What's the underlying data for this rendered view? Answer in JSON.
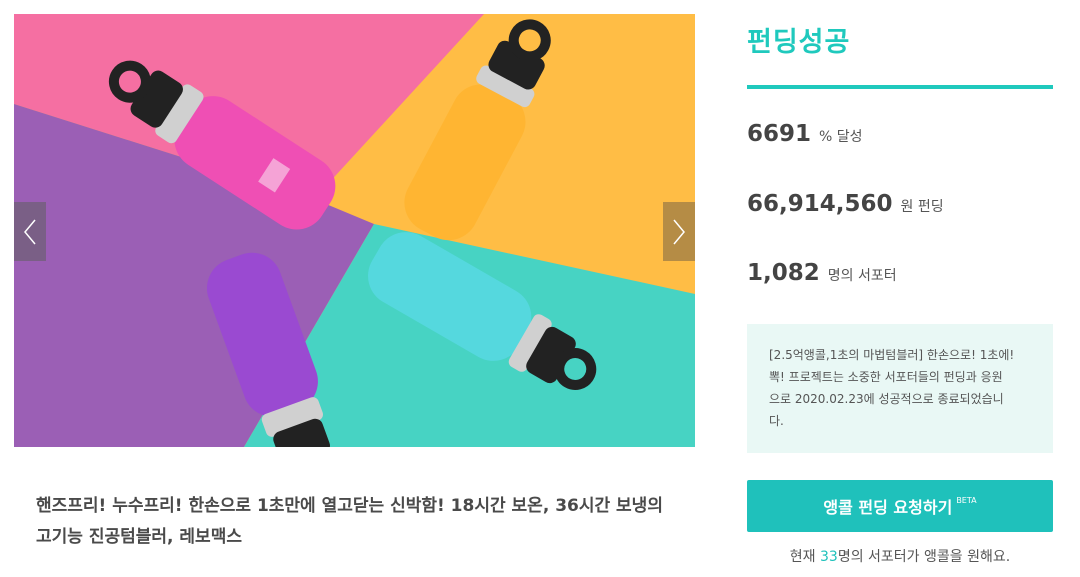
{
  "gallery": {
    "prev_icon": "chevron-left-icon",
    "next_icon": "chevron-right-icon",
    "bottle_brand": "REVOMAX",
    "colors": {
      "pink": "#f06aa0",
      "orange": "#ffbd45",
      "purple": "#9d62b8",
      "teal": "#46d2c4"
    }
  },
  "project": {
    "title": "핸즈프리! 누수프리! 한손으로 1초만에 열고닫는 신박함! 18시간 보온, 36시간 보냉의 고기능 진공텀블러, 레보맥스"
  },
  "status": {
    "label": "펀딩성공",
    "accent": "#1fc9bd"
  },
  "stats": {
    "percent": {
      "value": "6691",
      "unit": "% 달성"
    },
    "amount": {
      "value": "66,914,560",
      "unit": "원 펀딩"
    },
    "backers": {
      "value": "1,082",
      "unit": "명의 서포터"
    }
  },
  "notice": {
    "line1": "[2.5억앵콜,1초의 마법텀블러] 한손으로! 1초에!",
    "line2": "뽁! 프로젝트는 소중한 서포터들의 펀딩과 응원",
    "line3": "으로 2020.02.23에 성공적으로 종료되었습니",
    "line4": "다."
  },
  "cta": {
    "label": "앵콜 펀딩 요청하기",
    "badge": "BETA"
  },
  "encore": {
    "prefix": "현재 ",
    "count": "33",
    "suffix": "명의 서포터가 앵콜을 원해요."
  }
}
